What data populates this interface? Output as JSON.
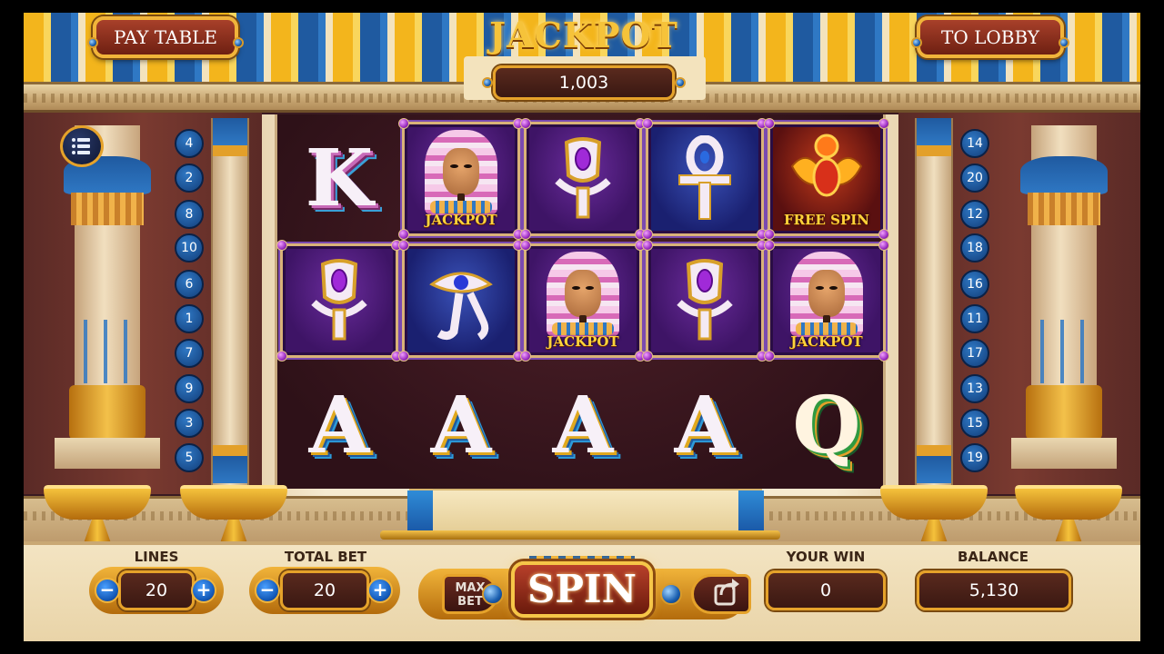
{
  "header": {
    "pay_table_label": "PAY TABLE",
    "to_lobby_label": "TO LOBBY",
    "jackpot_title": "JACKPOT",
    "jackpot_value": "1,003"
  },
  "menu": {
    "icon": "menu-list-icon"
  },
  "left_lines": [
    "4",
    "2",
    "8",
    "10",
    "6",
    "1",
    "7",
    "9",
    "3",
    "5"
  ],
  "right_lines": [
    "14",
    "20",
    "12",
    "18",
    "16",
    "11",
    "17",
    "13",
    "15",
    "19"
  ],
  "reels": {
    "row1": [
      "K",
      "pharaoh",
      "ankh-purple",
      "ankh-blue",
      "scarab"
    ],
    "row2": [
      "ankh-purple",
      "eye-of-horus",
      "pharaoh",
      "ankh-purple",
      "pharaoh"
    ],
    "row3": [
      "A",
      "A",
      "A",
      "A",
      "Q"
    ],
    "jackpot_caption": "JACKPOT",
    "free_spin_caption": "FREE SPIN"
  },
  "symbols": {
    "r1c1": "K",
    "r3c1": "A",
    "r3c2": "A",
    "r3c3": "A",
    "r3c4": "A",
    "r3c5": "Q"
  },
  "captions": {
    "r1c2": "JACKPOT",
    "r1c5": "FREE SPIN",
    "r2c3": "JACKPOT",
    "r2c5": "JACKPOT"
  },
  "bottom": {
    "lines_label": "LINES",
    "lines_value": "20",
    "total_bet_label": "TOTAL BET",
    "total_bet_value": "20",
    "minus": "−",
    "plus": "+",
    "max_bet_label": "MAX BET",
    "spin_label": "SPIN",
    "autoplay_icon": "autoplay-arrow-icon",
    "your_win_label": "YOUR WIN",
    "your_win_value": "0",
    "balance_label": "BALANCE",
    "balance_value": "5,130"
  },
  "colors": {
    "gold": "#f1b43a",
    "blue": "#1f5aa0",
    "maroon": "#3a1812",
    "tile_purple": "#6a2c9c"
  }
}
